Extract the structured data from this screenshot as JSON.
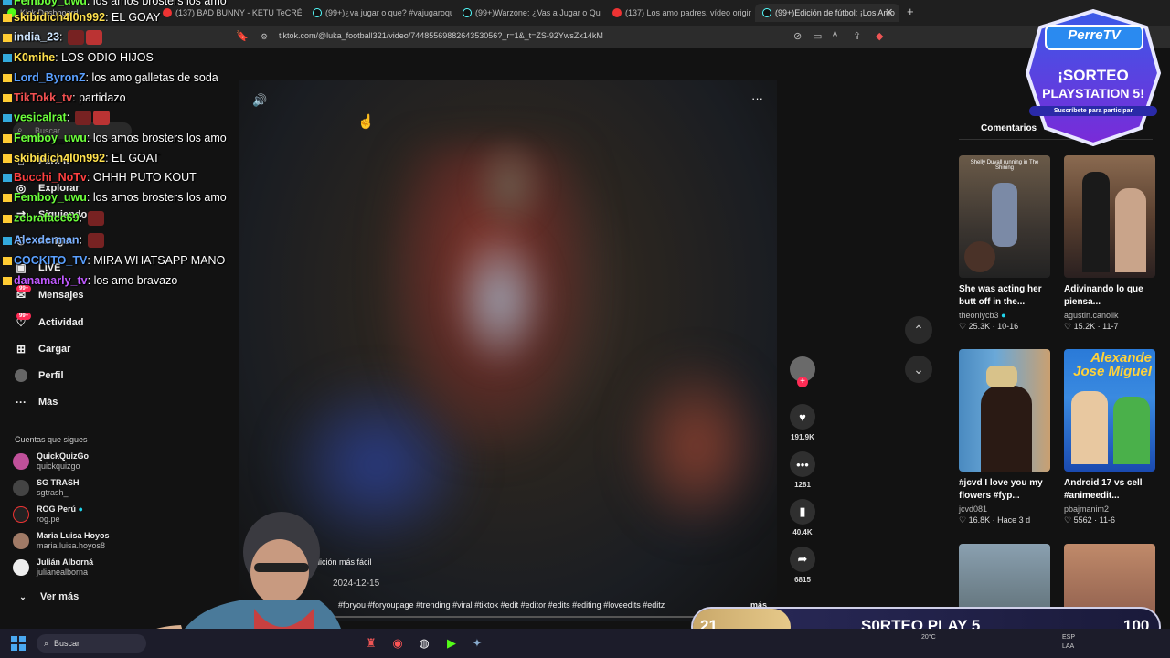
{
  "browser": {
    "tabs": [
      {
        "title": "Kick Dashboard",
        "icon": "kick"
      },
      {
        "title": "(137) BAD BUNNY - KETU TeCRÉ (Vid",
        "icon": "youtube"
      },
      {
        "title": "(99+)¿va jugar o que? #vajugaroque",
        "icon": "tiktok"
      },
      {
        "title": "(99+)Warzone: ¿Vas a Jugar o Qué? |",
        "icon": "tiktok"
      },
      {
        "title": "(137) Los amo padres, vídeo original",
        "icon": "youtube"
      },
      {
        "title": "(99+)Edición de fútbol: ¡Los Amo",
        "icon": "tiktok",
        "active": true
      }
    ],
    "url": "tiktok.com/@luka_football321/video/7448556988264353056?_r=1&_t=ZS-92YwsZx14kM"
  },
  "sidebar": {
    "search_placeholder": "Buscar",
    "items": [
      {
        "label": "Para ti",
        "icon": "home-icon"
      },
      {
        "label": "Explorar",
        "icon": "compass-icon"
      },
      {
        "label": "Siguiendo",
        "icon": "following-icon"
      },
      {
        "label": "Amigos",
        "icon": "friends-icon"
      },
      {
        "label": "LIVE",
        "icon": "live-icon"
      },
      {
        "label": "Mensajes",
        "icon": "message-icon",
        "badge": "99+"
      },
      {
        "label": "Actividad",
        "icon": "activity-icon",
        "badge": "99+"
      },
      {
        "label": "Cargar",
        "icon": "upload-icon"
      },
      {
        "label": "Perfil",
        "icon": "profile-icon"
      },
      {
        "label": "Más",
        "icon": "more-icon"
      }
    ],
    "following_title": "Cuentas que sigues",
    "following": [
      {
        "name": "QuickQuizGo",
        "handle": "quickquizgo"
      },
      {
        "name": "SG TRASH",
        "handle": "sgtrash_"
      },
      {
        "name": "ROG Perú",
        "handle": "rog.pe",
        "verified": true
      },
      {
        "name": "Maria Luisa Hoyos",
        "handle": "maria.luisa.hoyos8"
      },
      {
        "name": "Julián Alborná",
        "handle": "julianealborna"
      }
    ],
    "see_more": "Ver más"
  },
  "chat": [
    {
      "user": "Femboy_uwu",
      "msg": "los amos brosters los amo",
      "color": "#6cff3b"
    },
    {
      "user": "skibidich4l0n992",
      "msg": "EL GOAY",
      "color": "#ffe14d"
    },
    {
      "user": "india_23",
      "msg": "",
      "color": "#cfe6ff",
      "emotes": 2
    },
    {
      "user": "K0mihe",
      "msg": "LOS ODIO HIJOS",
      "color": "#ffe14d"
    },
    {
      "user": "Lord_ByronZ",
      "msg": "los amo galletas de soda",
      "color": "#5aa0ff"
    },
    {
      "user": "TikTokk_tv",
      "msg": "partidazo",
      "color": "#f05050"
    },
    {
      "user": "vesicalrat",
      "msg": "",
      "color": "#6cff3b",
      "emotes": 2
    },
    {
      "user": "Femboy_uwu",
      "msg": "los amos brosters los amo",
      "color": "#6cff3b"
    },
    {
      "user": "skibidich4l0n992",
      "msg": "EL GOAT",
      "color": "#ffe14d"
    },
    {
      "user": "Bucchi_NoTv",
      "msg": "OHHH PUTO KOUT",
      "color": "#ff4040"
    },
    {
      "user": "Femboy_uwu",
      "msg": "los amos brosters los amo",
      "color": "#6cff3b"
    },
    {
      "user": "zebraface69",
      "msg": "",
      "color": "#6cff3b",
      "emotes": 1
    },
    {
      "user": "Alexderman",
      "msg": "",
      "color": "#7ab0ff",
      "emotes": 1
    },
    {
      "user": "COCKITO_TV",
      "msg": "MIRA WHATSAPP MANO",
      "color": "#5aa0ff"
    },
    {
      "user": "danamarly_tv",
      "msg": "los amo bravazo",
      "color": "#c05aff"
    }
  ],
  "video": {
    "caption": "edición más fácil",
    "date": "2024-12-15",
    "hashtags": "#foryou #foryoupage #trending #viral #tiktok #edit #editor #edits #editing #loveedits #editz",
    "more": "más"
  },
  "actions": {
    "likes": "191.9K",
    "comments": "1281",
    "saves": "40.4K",
    "shares": "6815"
  },
  "right_panel": {
    "tab": "Comentarios",
    "cards": [
      {
        "title": "She was acting her butt off in the...",
        "author": "theonlycb3",
        "verified": true,
        "meta": "25.3K · 10-16",
        "thumb_text": "Shelly Duvall running in The Shining"
      },
      {
        "title": "Adivinando lo que piensa...",
        "author": "agustin.canolik",
        "meta": "15.2K · 11-7"
      },
      {
        "title": "#jcvd I love you my flowers #fyp...",
        "author": "jcvd081",
        "meta": "16.8K · Hace 3 d"
      },
      {
        "title": "Android 17 vs cell #animeedit...",
        "author": "pbajmanim2",
        "meta": "5562 · 11-6",
        "thumb_text": "Alexande Jose Miguel"
      },
      {
        "title": "",
        "author": "",
        "meta": ""
      },
      {
        "title": "",
        "author": "",
        "meta": ""
      }
    ]
  },
  "overlay": {
    "brand": "PerreTV",
    "promo_line1": "¡SORTEO",
    "promo_line2": "PLAYSTATION 5!",
    "promo_sub": "Suscríbete para participar",
    "sorteo_count": 21,
    "sorteo_title": "S0RTEO PLAY 5",
    "sorteo_goal": 100,
    "sorteo_goal_label": "100"
  },
  "taskbar": {
    "search": "Buscar",
    "weather": "20°C",
    "lang": "ESP",
    "lang2": "LAA"
  },
  "colors": {
    "tiktok_red": "#fe2c55",
    "bg": "#121212"
  }
}
